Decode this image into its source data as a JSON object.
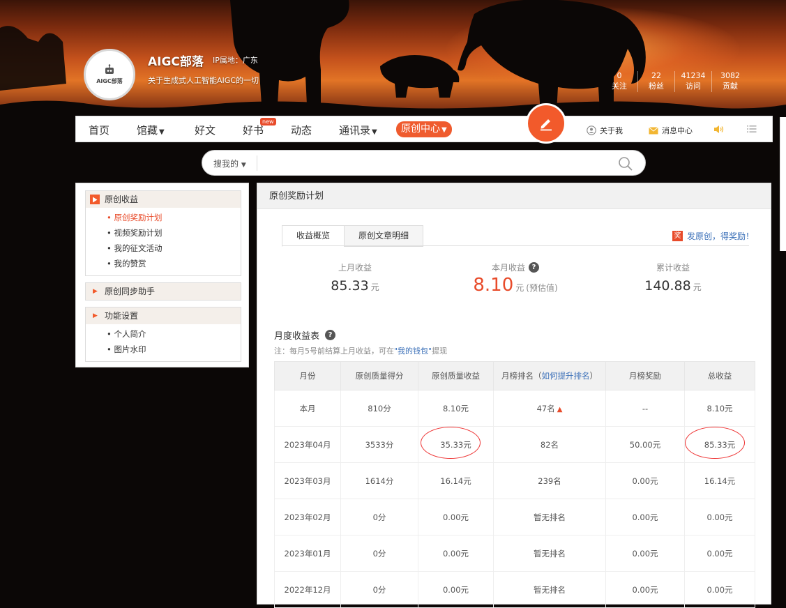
{
  "header": {
    "blog_title": "AIGC部落",
    "ip_location": "IP属地：广东",
    "description": "关于生成式人工智能AIGC的一切",
    "avatar_text": "AIGC部落",
    "stats": [
      {
        "value": "0",
        "label": "关注"
      },
      {
        "value": "22",
        "label": "粉丝"
      },
      {
        "value": "41234",
        "label": "访问"
      },
      {
        "value": "3082",
        "label": "贡献"
      }
    ]
  },
  "nav": {
    "items": [
      {
        "label": "首页"
      },
      {
        "label": "馆藏"
      },
      {
        "label": "好文"
      },
      {
        "label": "好书"
      },
      {
        "label": "动态"
      },
      {
        "label": "通讯录"
      }
    ],
    "new_badge": "new",
    "original_center": "原创中心",
    "about_me": "关于我",
    "messages": "消息中心",
    "colors": {
      "accent": "#f25a2b",
      "link": "#3a6fb8"
    }
  },
  "search": {
    "scope": "搜我的",
    "placeholder": ""
  },
  "sidebar": {
    "groups": [
      {
        "title": "原创收益",
        "items": [
          "原创奖励计划",
          "视频奖励计划",
          "我的征文活动",
          "我的赞赏"
        ]
      },
      {
        "title": "原创同步助手",
        "items": []
      },
      {
        "title": "功能设置",
        "items": [
          "个人简介",
          "图片水印"
        ]
      }
    ]
  },
  "main": {
    "title": "原创奖励计划",
    "tabs": [
      "收益概览",
      "原创文章明细"
    ],
    "reward_tag": "奖",
    "reward_link": "发原创，得奖励！",
    "summary": {
      "last_month": {
        "label": "上月收益",
        "value": "85.33",
        "unit": "元"
      },
      "this_month": {
        "label": "本月收益",
        "value": "8.10",
        "unit": "元",
        "note": "(预估值)"
      },
      "total": {
        "label": "累计收益",
        "value": "140.88",
        "unit": "元"
      }
    },
    "table_title": "月度收益表",
    "note_prefix": "注：每月5号前结算上月收益，可在",
    "note_link": "\"我的钱包\"",
    "note_suffix": "提现",
    "table": {
      "headers": [
        "月份",
        "原创质量得分",
        "原创质量收益",
        "月榜排名（",
        "如何提升排名",
        "）",
        "月榜奖励",
        "总收益"
      ],
      "rows": [
        [
          "本月",
          "810分",
          "8.10元",
          "47名",
          "--",
          "8.10元"
        ],
        [
          "2023年04月",
          "3533分",
          "35.33元",
          "82名",
          "50.00元",
          "85.33元"
        ],
        [
          "2023年03月",
          "1614分",
          "16.14元",
          "239名",
          "0.00元",
          "16.14元"
        ],
        [
          "2023年02月",
          "0分",
          "0.00元",
          "暂无排名",
          "0.00元",
          "0.00元"
        ],
        [
          "2023年01月",
          "0分",
          "0.00元",
          "暂无排名",
          "0.00元",
          "0.00元"
        ],
        [
          "2022年12月",
          "0分",
          "0.00元",
          "暂无排名",
          "0.00元",
          "0.00元"
        ]
      ]
    }
  }
}
